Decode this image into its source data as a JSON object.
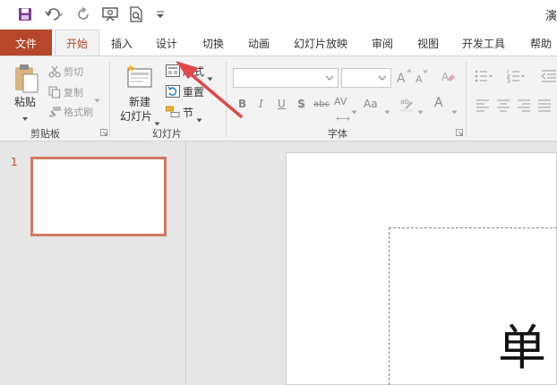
{
  "window": {
    "title_fragment": "演"
  },
  "qat": {
    "icons": [
      "save-icon",
      "undo-icon",
      "redo-icon",
      "present-icon",
      "print-preview-icon",
      "customize-dropdown-icon"
    ]
  },
  "tabs": {
    "file": "文件",
    "items": [
      "开始",
      "插入",
      "设计",
      "切换",
      "动画",
      "幻灯片放映",
      "审阅",
      "视图",
      "开发工具",
      "帮助"
    ],
    "active": "开始"
  },
  "ribbon": {
    "clipboard": {
      "paste": "粘贴",
      "cut": "剪切",
      "copy": "复制",
      "format_painter": "格式刷",
      "label": "剪贴板"
    },
    "slides": {
      "new_slide_line1": "新建",
      "new_slide_line2": "幻灯片",
      "layout": "版式",
      "reset": "重置",
      "section": "节",
      "label": "幻灯片"
    },
    "font": {
      "label": "字体",
      "font_name": "",
      "font_size": "",
      "bold": "B",
      "italic": "I",
      "underline": "U",
      "shadow": "S",
      "strike": "abc",
      "spacing": "AV",
      "case": "Aa",
      "color": "A"
    }
  },
  "slides_pane": {
    "slide_number": "1"
  },
  "slide": {
    "visible_text": "单"
  },
  "colors": {
    "accent": "#b7472a",
    "thumb_border": "#d27a60",
    "arrow": "#e04848"
  }
}
